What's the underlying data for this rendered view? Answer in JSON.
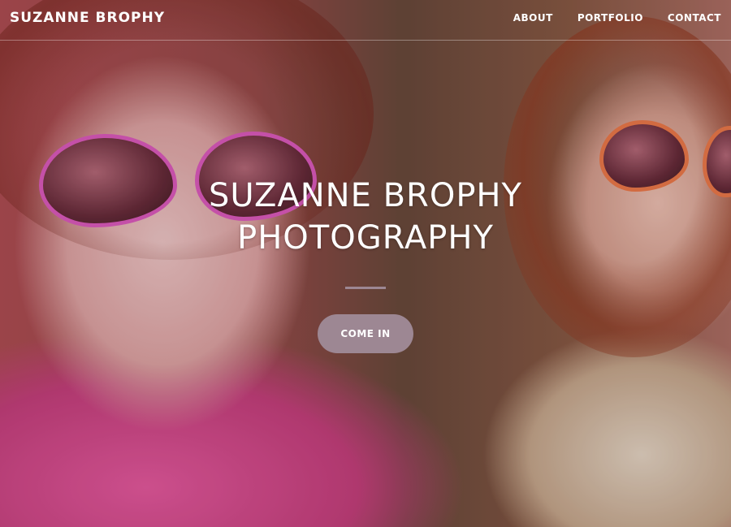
{
  "nav": {
    "brand": "SUZANNE BROPHY",
    "links": [
      "ABOUT",
      "PORTFOLIO",
      "CONTACT"
    ]
  },
  "hero": {
    "title_line1": "SUZANNE BROPHY",
    "title_line2": "PHOTOGRAPHY",
    "cta_label": "COME IN"
  },
  "colors": {
    "accent": "#9d8793",
    "text": "#ffffff"
  }
}
